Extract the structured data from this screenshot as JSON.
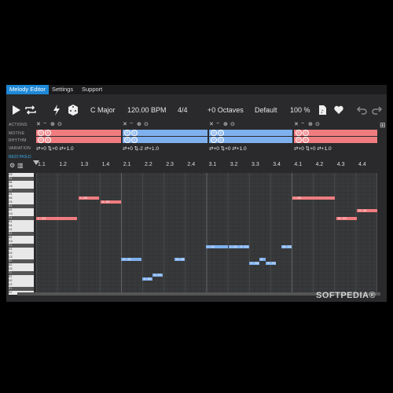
{
  "tabs": [
    {
      "label": "Melody Editor",
      "active": true
    },
    {
      "label": "Settings",
      "active": false
    },
    {
      "label": "Support",
      "active": false
    }
  ],
  "toolbar": {
    "key": "C Major",
    "tempo": "120.00 BPM",
    "time_signature": "4/4",
    "octaves": "+0 Octaves",
    "preset": "Default",
    "zoom": "100 %",
    "icons": [
      "play-icon",
      "loop-icon",
      "lightning-icon",
      "dice-icon",
      "file-icon",
      "heart-icon",
      "undo-icon",
      "redo-icon"
    ]
  },
  "rows": {
    "actions": "ACTIONS",
    "motive": "MOTIVE",
    "rhythm": "RHYTHM",
    "variation": "VARIATION",
    "rest_hold": "REST/HOLD"
  },
  "sections": [
    {
      "color": "red",
      "variation": "⇄+0  ⇅+0  ⇄+1.0"
    },
    {
      "color": "blue",
      "variation": "⇄+0  ⇅-2  ⇄+1.0"
    },
    {
      "color": "blue",
      "variation": "⇄+0  ⇅+0  ⇄+1.0"
    },
    {
      "color": "red",
      "variation": "⇄+0  ⇅+0  ⇄+1.0"
    }
  ],
  "ruler": [
    "1.1",
    "1.2",
    "1.3",
    "1.4",
    "2.1",
    "2.2",
    "2.3",
    "2.4",
    "3.1",
    "3.2",
    "3.3",
    "3.4",
    "4.1",
    "4.2",
    "4.3",
    "4.4"
  ],
  "keys": [
    "C6",
    "B5",
    "A5",
    "G5",
    "F5",
    "E5",
    "D5",
    "C5",
    "B4",
    "A4",
    "G4",
    "F4",
    "E4",
    "D4",
    "C4",
    "B3",
    "A3",
    "G3",
    "F3",
    "E3",
    "D3",
    "C3",
    "B2",
    "A2",
    "G2",
    "F2",
    "E2",
    "D2",
    "C2",
    "B1",
    "A1"
  ],
  "notes": [
    {
      "label": "I - G5",
      "color": "red"
    },
    {
      "label": "II - E5",
      "color": "red"
    },
    {
      "label": "V - D4",
      "color": "red"
    },
    {
      "label": "I - G5",
      "color": "red"
    },
    {
      "label": "VI - E4",
      "color": "red"
    },
    {
      "label": "IV - A4",
      "color": "red"
    },
    {
      "label": "VI - A3",
      "color": "blue"
    },
    {
      "label": "IV - A3",
      "color": "blue"
    },
    {
      "label": "II - E2",
      "color": "blue"
    },
    {
      "label": "II - F2",
      "color": "blue"
    },
    {
      "label": "I - C4",
      "color": "blue"
    },
    {
      "label": "I - C4",
      "color": "blue"
    },
    {
      "label": "II - C4",
      "color": "blue"
    },
    {
      "label": "V - D3",
      "color": "blue"
    },
    {
      "label": "VI - E3",
      "color": "blue"
    },
    {
      "label": "II",
      "color": "blue"
    },
    {
      "label": "III - C4",
      "color": "blue"
    }
  ],
  "watermark": "SOFTPEDIA®"
}
